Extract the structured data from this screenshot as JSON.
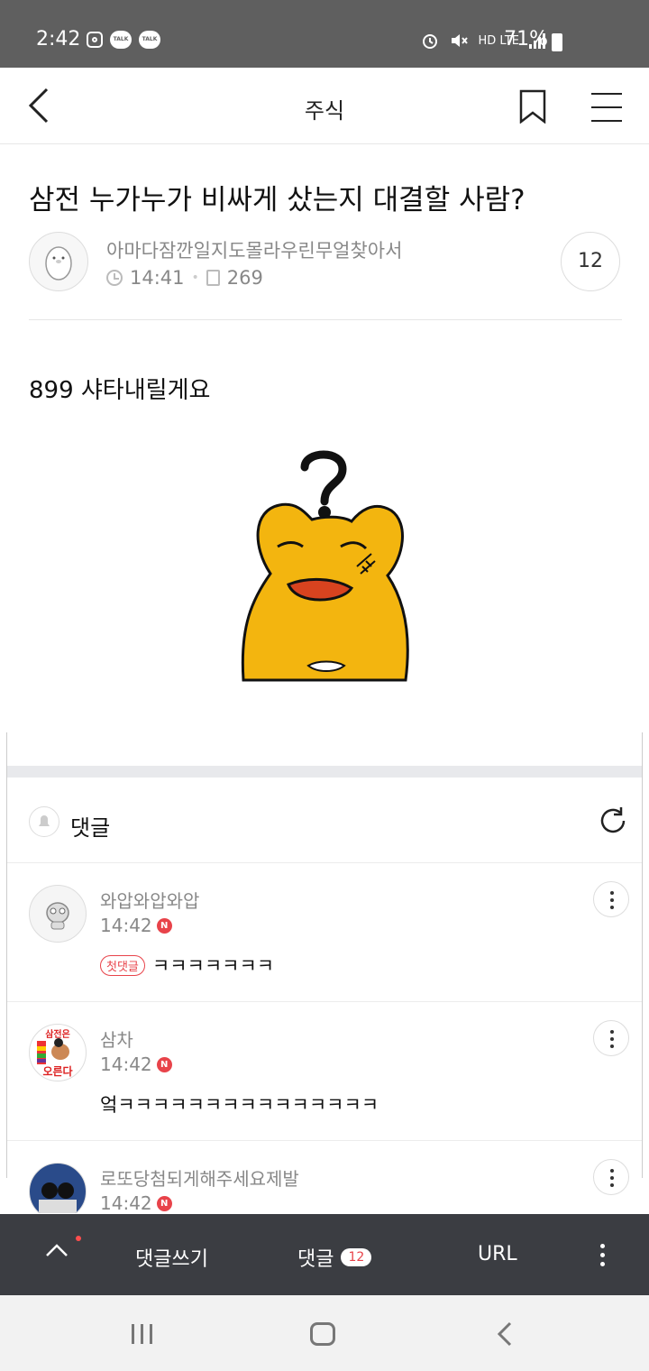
{
  "status_bar": {
    "time": "2:42",
    "talk1": "TALK",
    "talk2": "TALK",
    "network": "HD LTE",
    "battery": "71%"
  },
  "header": {
    "title": "주식"
  },
  "post": {
    "title": "삼전 누가누가 비싸게 샀는지 대결할 사람?",
    "author": "아마다잠깐일지도몰라우린무얼찾아서",
    "time": "14:41",
    "views": "269",
    "comment_count": "12",
    "body": "899 샤타내릴게요"
  },
  "comments_section": {
    "label": "댓글",
    "items": [
      {
        "name": "와압와압와압",
        "time": "14:42",
        "badge": "N",
        "tag": "첫댓글",
        "text": "ㅋㅋㅋㅋㅋㅋㅋ"
      },
      {
        "name": "삼차",
        "time": "14:42",
        "badge": "N",
        "avatar_text_top": "삼전은",
        "avatar_text_bottom": "오른다",
        "text": "엌ㅋㅋㅋㅋㅋㅋㅋㅋㅋㅋㅋㅋㅋㅋㅋ"
      },
      {
        "name": "로또당첨되게해주세요제발",
        "time": "14:42",
        "badge": "N"
      }
    ]
  },
  "bottom_bar": {
    "write": "댓글쓰기",
    "comments": "댓글",
    "count": "12",
    "url": "URL"
  },
  "colors": {
    "accent_red": "#e8434a",
    "bottom_bar": "#3b3d42",
    "status_bar": "#5f5f5f"
  }
}
